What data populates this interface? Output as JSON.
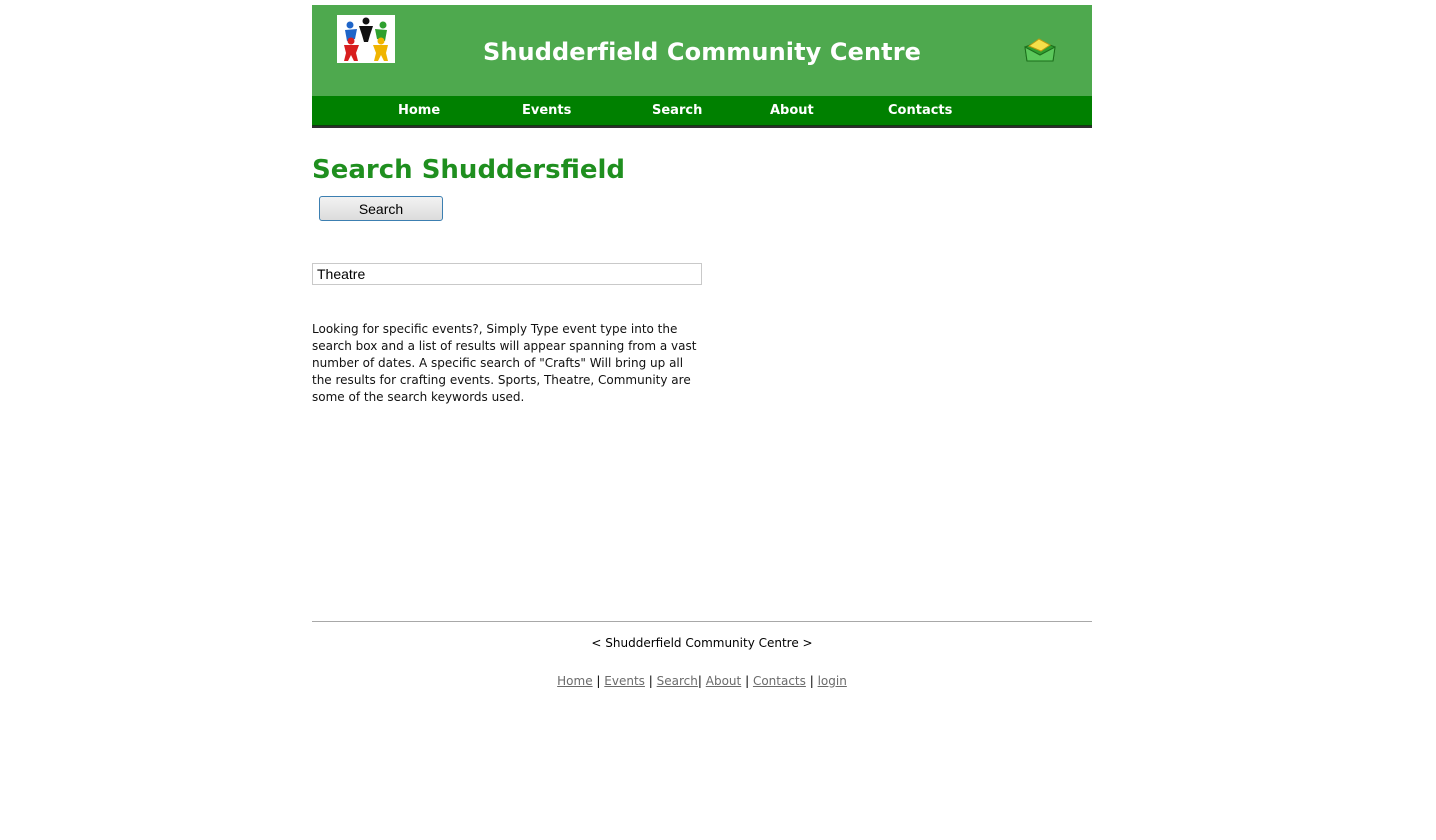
{
  "header": {
    "site_title": "Shudderfield Community Centre",
    "logo_icon": "people-circle-logo-icon",
    "mail_icon": "open-envelope-icon",
    "colors": {
      "header_bg": "#4ea94e",
      "nav_bg": "#008000",
      "heading": "#1f8f1f"
    }
  },
  "nav": {
    "items": [
      {
        "label": "Home"
      },
      {
        "label": "Events"
      },
      {
        "label": "Search"
      },
      {
        "label": "About"
      },
      {
        "label": "Contacts"
      }
    ]
  },
  "main": {
    "heading": "Search Shuddersfield",
    "search_button_label": "Search",
    "search_value": "Theatre",
    "help_text": "Looking for specific events?, Simply Type event type into the search box and a list of results will appear spanning from a vast number of dates. A specific search of \"Crafts\" Will bring up all the results for crafting events. Sports, Theatre, Community are some of the search keywords used."
  },
  "footer": {
    "title": "< Shudderfield Community Centre >",
    "links": [
      {
        "label": "Home"
      },
      {
        "label": "Events"
      },
      {
        "label": "Search"
      },
      {
        "label": "About"
      },
      {
        "label": "Contacts"
      },
      {
        "label": "login"
      }
    ],
    "separator": "|"
  }
}
